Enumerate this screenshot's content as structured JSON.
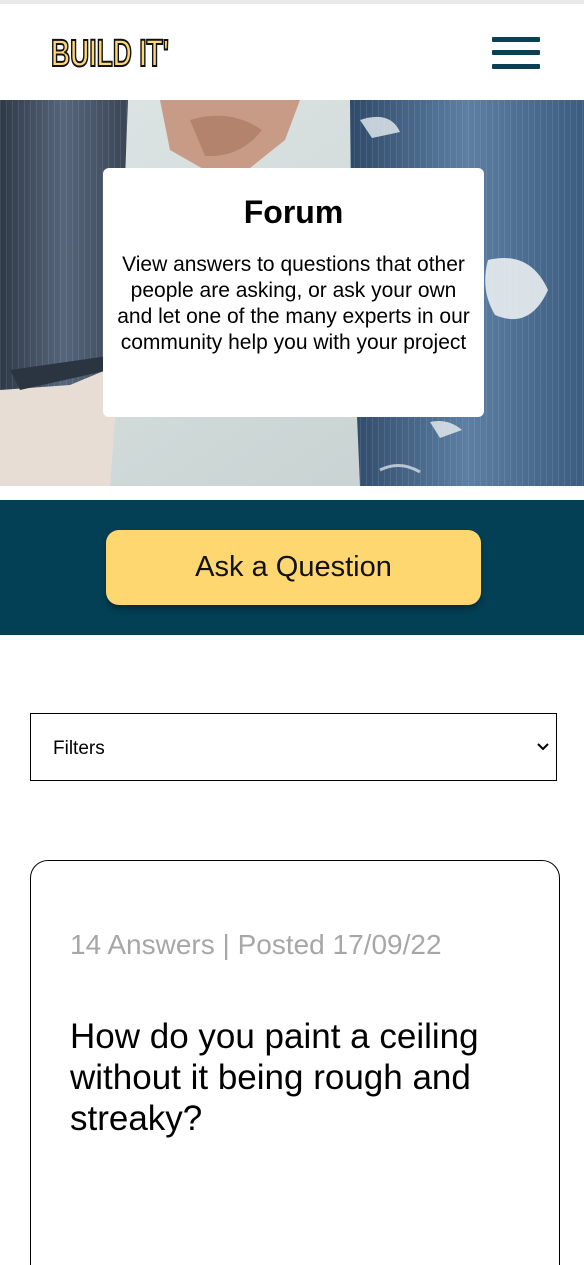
{
  "header": {
    "logo_text": "BUILD IT'",
    "menu_icon": "hamburger-menu-icon"
  },
  "hero": {
    "title": "Forum",
    "description": "View answers to questions that other people are asking, or ask your own and let one of the many experts in our community help you with your project"
  },
  "cta": {
    "label": "Ask a Question"
  },
  "filters": {
    "selected": "Filters",
    "icon": "chevron-down-icon"
  },
  "questions": [
    {
      "meta": "14 Answers | Posted 17/09/22",
      "title": "How do you paint a ceiling without it being rough and streaky?"
    }
  ],
  "colors": {
    "brand_dark": "#034055",
    "accent_yellow": "#ffd771",
    "menu_icon": "#0b3f53",
    "meta_text": "#a7a7a7"
  }
}
